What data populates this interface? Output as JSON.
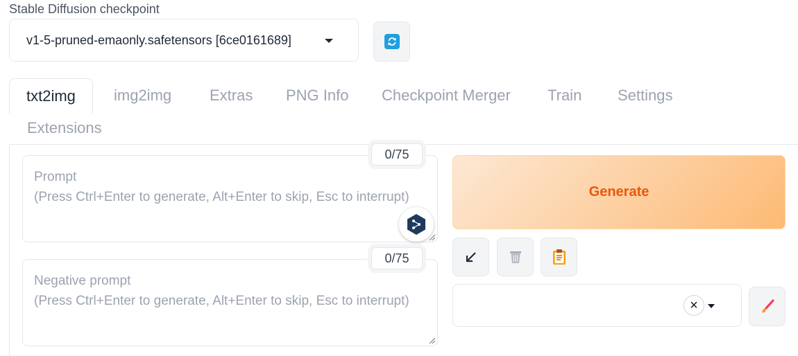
{
  "checkpoint": {
    "label": "Stable Diffusion checkpoint",
    "value": "v1-5-pruned-emaonly.safetensors [6ce0161689]"
  },
  "tabs": [
    {
      "label": "txt2img",
      "active": true
    },
    {
      "label": "img2img"
    },
    {
      "label": "Extras"
    },
    {
      "label": "PNG Info"
    },
    {
      "label": "Checkpoint Merger"
    },
    {
      "label": "Train"
    },
    {
      "label": "Settings"
    },
    {
      "label": "Extensions"
    }
  ],
  "prompt": {
    "placeholder_line1": "Prompt",
    "placeholder_line2": "(Press Ctrl+Enter to generate, Alt+Enter to skip, Esc to interrupt)",
    "token_count": "0/75"
  },
  "negative_prompt": {
    "placeholder_line1": "Negative prompt",
    "placeholder_line2": "(Press Ctrl+Enter to generate, Alt+Enter to skip, Esc to interrupt)",
    "token_count": "0/75"
  },
  "generate": {
    "label": "Generate"
  },
  "tools": {
    "clear_symbol": "×"
  },
  "colors": {
    "accent": "#ea580c",
    "refresh_icon": "#1f9fe0",
    "brush_icon": "#f43f5e"
  },
  "icons": {
    "refresh": "refresh-icon",
    "read_params": "arrow-down-left-icon",
    "trash": "trash-icon",
    "clipboard": "clipboard-icon",
    "brush": "paint-brush-icon",
    "extension_badge": "hexagon-share-icon"
  }
}
